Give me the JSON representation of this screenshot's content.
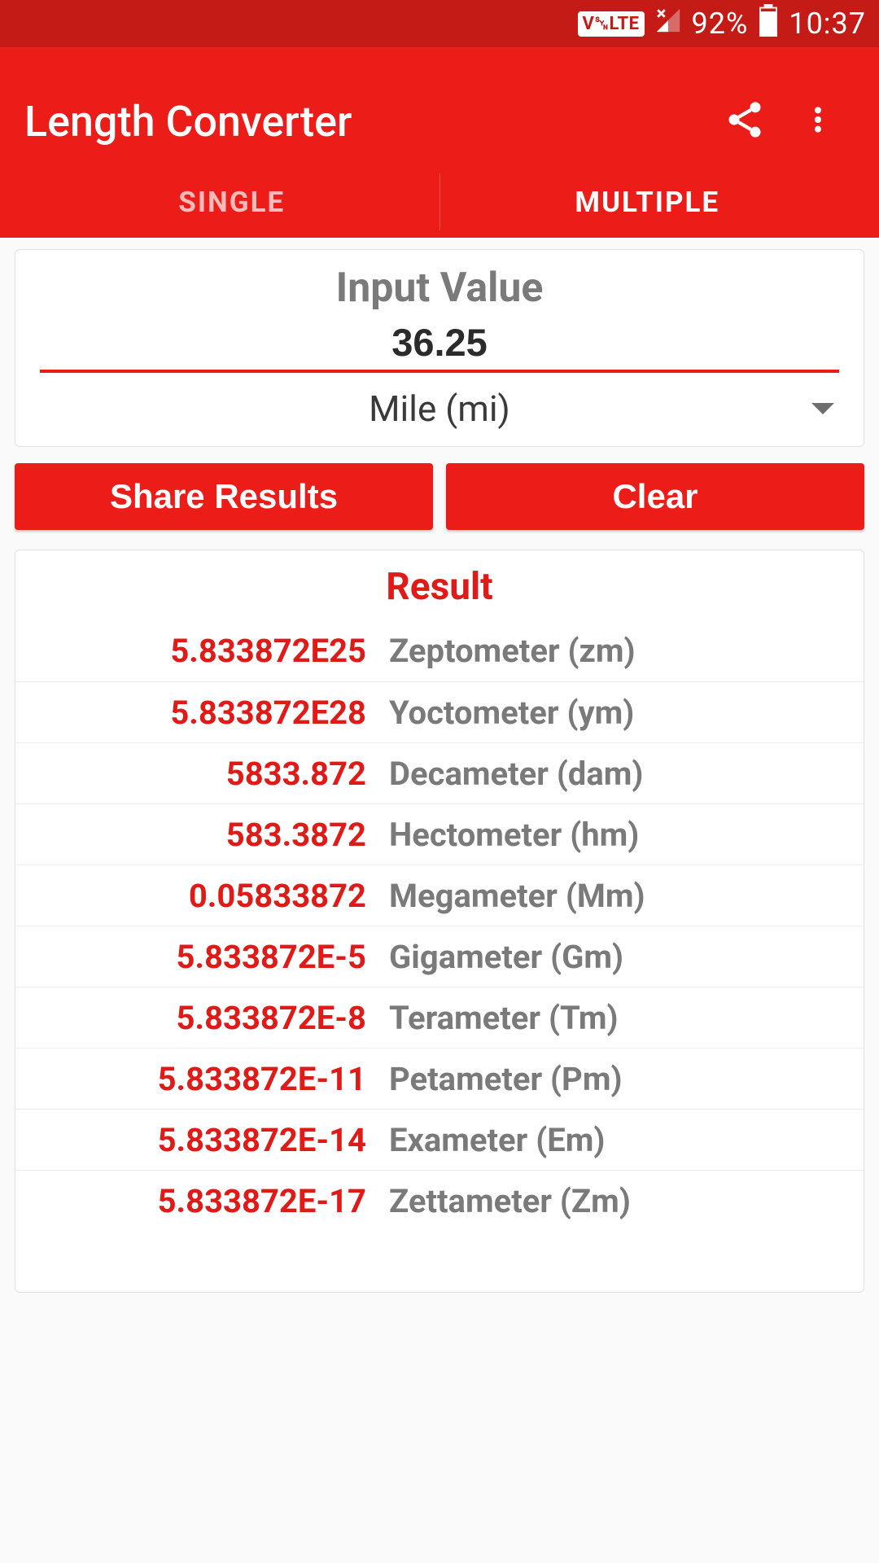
{
  "status_bar": {
    "volte": "V␖LTE",
    "battery_pct": "92%",
    "time": "10:37"
  },
  "app_bar": {
    "title": "Length Converter"
  },
  "tabs": {
    "single": "SINGLE",
    "multiple": "MULTIPLE"
  },
  "input": {
    "label": "Input Value",
    "value": "36.25",
    "unit": "Mile (mi)"
  },
  "buttons": {
    "share": "Share Results",
    "clear": "Clear"
  },
  "results": {
    "header": "Result",
    "rows": [
      {
        "value": "5.833872E25",
        "unit": "Zeptometer (zm)"
      },
      {
        "value": "5.833872E28",
        "unit": "Yoctometer (ym)"
      },
      {
        "value": "5833.872",
        "unit": "Decameter (dam)"
      },
      {
        "value": "583.3872",
        "unit": "Hectometer (hm)"
      },
      {
        "value": "0.05833872",
        "unit": "Megameter (Mm)"
      },
      {
        "value": "5.833872E-5",
        "unit": "Gigameter (Gm)"
      },
      {
        "value": "5.833872E-8",
        "unit": "Terameter (Tm)"
      },
      {
        "value": "5.833872E-11",
        "unit": "Petameter (Pm)"
      },
      {
        "value": "5.833872E-14",
        "unit": "Exameter (Em)"
      },
      {
        "value": "5.833872E-17",
        "unit": "Zettameter (Zm)"
      }
    ]
  }
}
